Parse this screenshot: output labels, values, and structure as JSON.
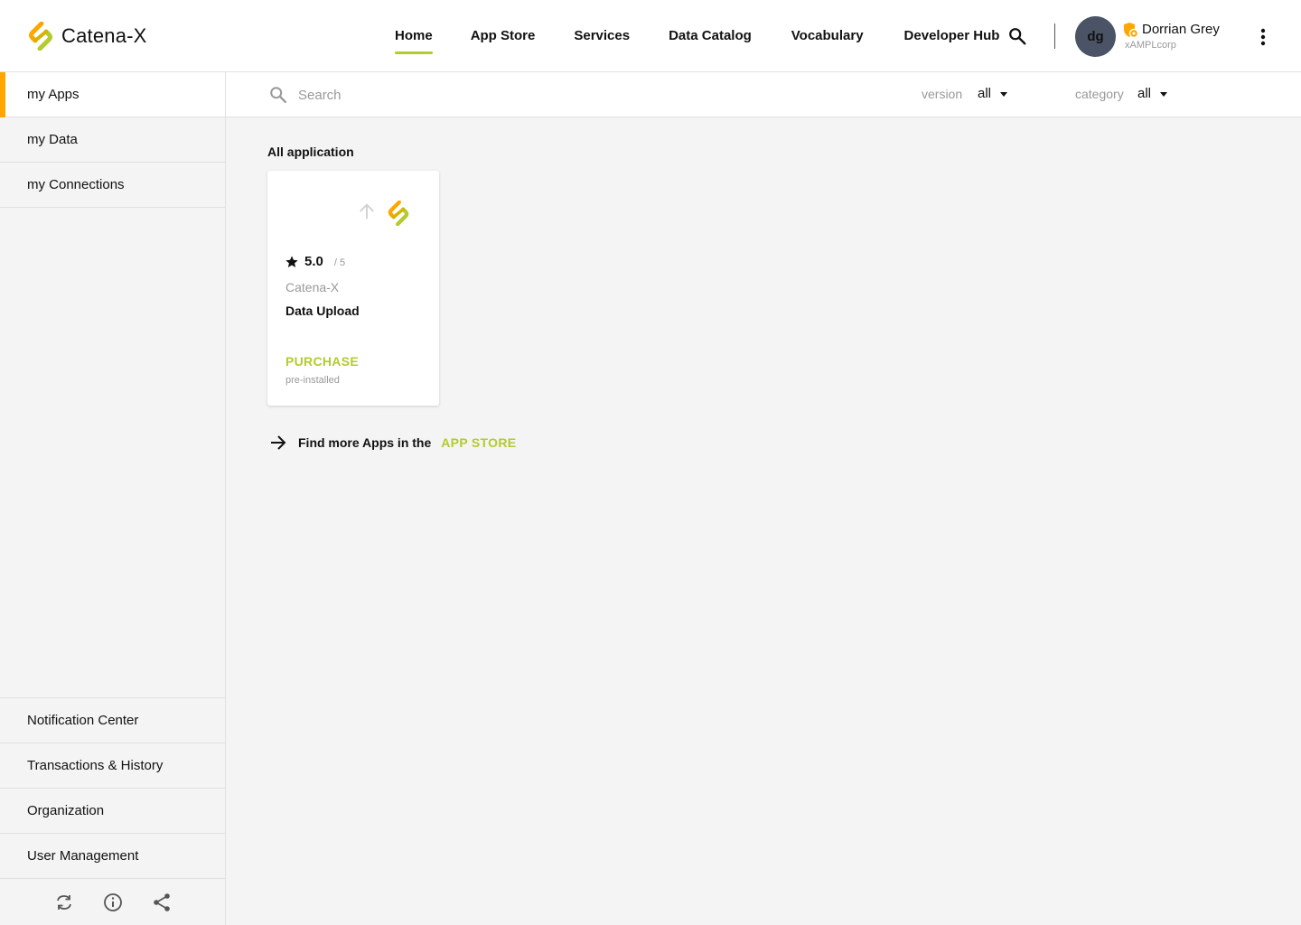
{
  "brand": {
    "name": "Catena-X",
    "accent": "#b3cb2d",
    "accent2": "#ffa600"
  },
  "nav": {
    "items": [
      {
        "label": "Home",
        "active": true
      },
      {
        "label": "App Store",
        "active": false
      },
      {
        "label": "Services",
        "active": false
      },
      {
        "label": "Data Catalog",
        "active": false
      },
      {
        "label": "Vocabulary",
        "active": false
      },
      {
        "label": "Developer Hub",
        "active": false
      }
    ],
    "search_icon": "search-icon",
    "more_icon": "more-vert-icon"
  },
  "user": {
    "initials": "dg",
    "name": "Dorrian Grey",
    "org": "xAMPLcorp",
    "badge_icon": "shield-badge-icon"
  },
  "sidebar": {
    "items": [
      {
        "label": "my Apps",
        "active": true
      },
      {
        "label": "my Data",
        "active": false
      },
      {
        "label": "my Connections",
        "active": false
      }
    ],
    "bottom_items": [
      {
        "label": "Notification Center"
      },
      {
        "label": "Transactions & History"
      },
      {
        "label": "Organization"
      },
      {
        "label": "User Management"
      }
    ],
    "footer_icons": [
      "sync-icon",
      "info-icon",
      "share-icon"
    ]
  },
  "filters": {
    "search_placeholder": "Search",
    "version_label": "version",
    "version_value": "all",
    "category_label": "category",
    "category_value": "all"
  },
  "main": {
    "section_title": "All application",
    "apps": [
      {
        "rating": "5.0",
        "rating_max": "/ 5",
        "vendor": "Catena-X",
        "title": "Data Upload",
        "action": "PURCHASE",
        "status": "pre-installed"
      }
    ],
    "find_more_text": "Find more Apps in the",
    "app_store_link": "APP STORE"
  }
}
